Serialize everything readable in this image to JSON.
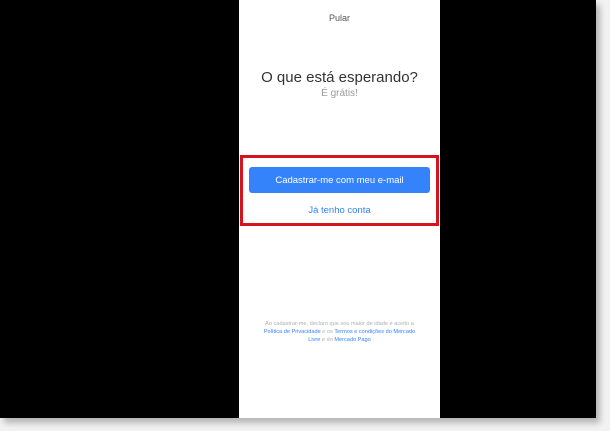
{
  "header": {
    "skip_label": "Pular"
  },
  "main": {
    "title": "O que está esperando?",
    "subtitle": "É grátis!",
    "signup_button_label": "Cadastrar-me com meu e-mail",
    "login_link_label": "Já tenho conta"
  },
  "footer": {
    "legal_prefix": "Ao cadastrar-me, declaro que sou maior de idade e aceito a ",
    "privacy_link": "Política de Privacidade",
    "connector_1": " e os ",
    "terms_link": "Termos e condições do Mercado Livre",
    "connector_2": " e do ",
    "mercado_pago_link": "Mercado Pago"
  },
  "colors": {
    "accent": "#3483fa",
    "highlight_border": "#d6141e",
    "screen_background": "#ffffff",
    "outer_background": "#000000"
  }
}
